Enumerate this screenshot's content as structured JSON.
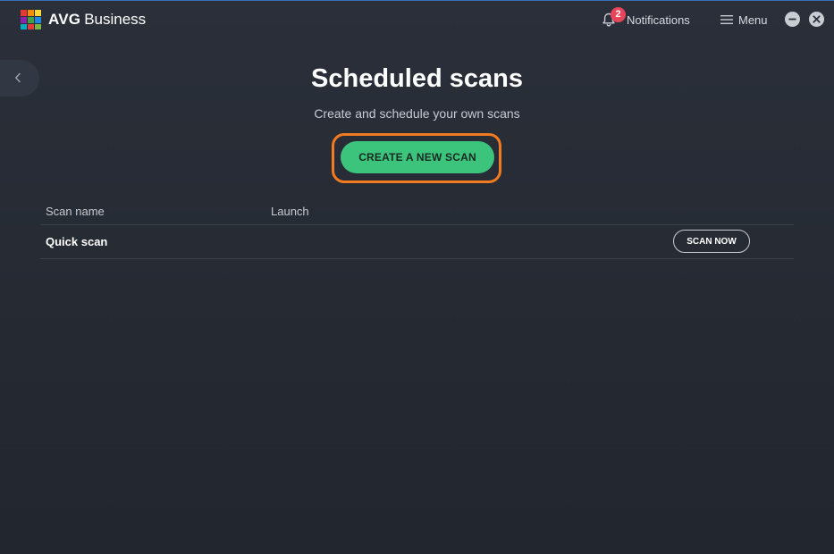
{
  "app": {
    "brand": "AVG",
    "product": "Business"
  },
  "header": {
    "notifications_label": "Notifications",
    "notifications_count": "2",
    "menu_label": "Menu"
  },
  "page": {
    "title": "Scheduled scans",
    "subtitle": "Create and schedule your own scans",
    "create_button_label": "CREATE A NEW SCAN"
  },
  "table": {
    "columns": [
      "Scan name",
      "Launch"
    ],
    "rows": [
      {
        "name": "Quick scan",
        "launch": "",
        "action_label": "SCAN NOW"
      }
    ]
  },
  "icons": {
    "back": "chevron-left-icon",
    "notifications": "bell-icon",
    "menu": "hamburger-icon",
    "minimize": "minimize-icon",
    "close": "close-icon"
  },
  "colors": {
    "accent_green": "#3cc47d",
    "highlight_orange": "#f27b21",
    "badge_red": "#e8455a",
    "background": "#262b34"
  }
}
